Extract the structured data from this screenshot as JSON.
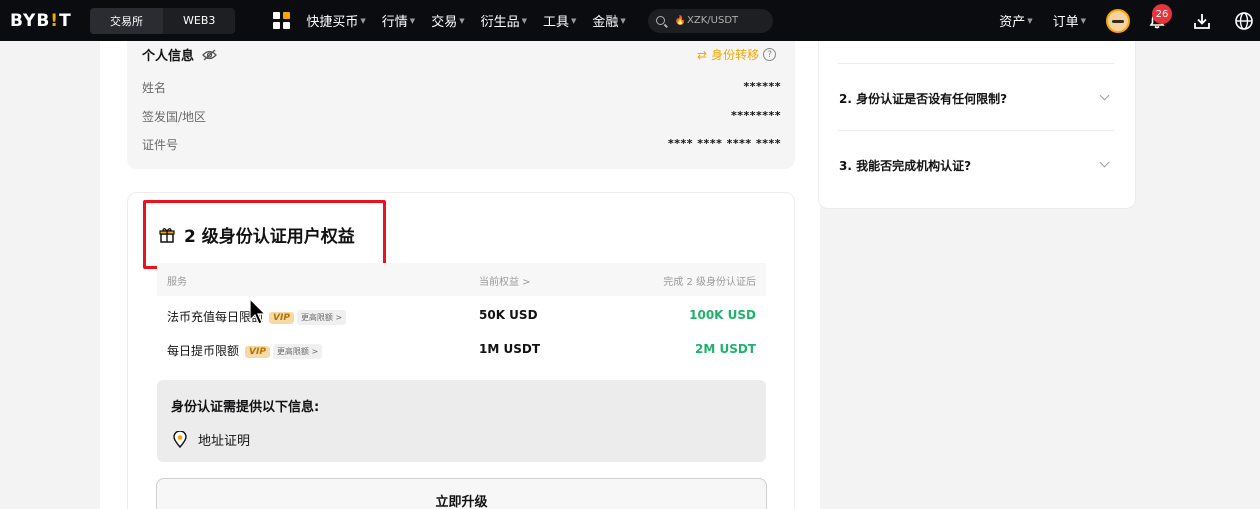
{
  "topbar": {
    "logo_left": "BYB",
    "logo_bang": "!",
    "logo_right": "T",
    "tabs": [
      "交易所",
      "WEB3"
    ],
    "nav": [
      "快捷买币",
      "行情",
      "交易",
      "衍生品",
      "工具",
      "金融"
    ],
    "search_text": "XZK/USDT",
    "right_nav": [
      "资产",
      "订单"
    ],
    "notification_count": "26"
  },
  "personal_info": {
    "title": "个人信息",
    "transfer_label": "身份转移",
    "fields": [
      {
        "label": "姓名",
        "value": "******"
      },
      {
        "label": "签发国/地区",
        "value": "********"
      },
      {
        "label": "证件号",
        "value": "**** **** **** ****"
      }
    ]
  },
  "benefits": {
    "title": "2 级身份认证用户权益",
    "headers": [
      "服务",
      "当前权益 >",
      "完成 2 级身份认证后"
    ],
    "vip_label": "VIP",
    "more_label": "更高限额 >",
    "rows": [
      {
        "service": "法币充值每日限额",
        "current": "50K USD",
        "after": "100K USD"
      },
      {
        "service": "每日提币限额",
        "current": "1M USDT",
        "after": "2M USDT"
      }
    ]
  },
  "requirements": {
    "title": "身份认证需提供以下信息:",
    "items": [
      "地址证明"
    ]
  },
  "upgrade_button": "立即升级",
  "faq": [
    "2. 身份认证是否设有任何限制?",
    "3. 我能否完成机构认证?"
  ],
  "colors": {
    "accent": "#f7a600",
    "positive": "#20b26c",
    "highlight_box": "#e8131c",
    "topbar_bg": "#0b0c0f"
  }
}
